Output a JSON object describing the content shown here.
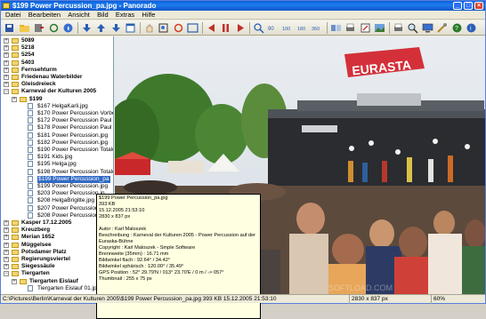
{
  "window": {
    "title": "$199 Power Percussion_pa.jpg - Panorado",
    "icon": "app-icon"
  },
  "menu": [
    "Datei",
    "Bearbeiten",
    "Ansicht",
    "Bild",
    "Extras",
    "Hilfe"
  ],
  "toolbar": [
    "save-icon",
    "folder-icon",
    "exit-icon",
    "refresh-icon",
    "info-icon",
    "arrow-down-icon",
    "arrow-up-icon",
    "arrow-down-icon",
    "new-window-icon",
    "hand-icon",
    "zoom-window-icon",
    "rotate-icon",
    "frame-icon",
    "play-left-icon",
    "pause-icon",
    "play-right-icon",
    "zoom-in-icon",
    "zoom-90-icon",
    "zoom-100-icon",
    "zoom-180-icon",
    "zoom-360-icon",
    "compare-icon",
    "print-icon",
    "edit-icon",
    "image-icon",
    "print-icon",
    "search-icon",
    "screen-icon",
    "settings-icon",
    "help-icon",
    "about-icon"
  ],
  "tree": [
    {
      "label": "5089",
      "type": "folder",
      "indent": 0,
      "bold": true
    },
    {
      "label": "5218",
      "type": "folder",
      "indent": 0,
      "bold": true
    },
    {
      "label": "5254",
      "type": "folder",
      "indent": 0,
      "bold": true
    },
    {
      "label": "5403",
      "type": "folder",
      "indent": 0,
      "bold": true
    },
    {
      "label": "Fernsehturm",
      "type": "folder",
      "indent": 0,
      "bold": true
    },
    {
      "label": "Friedenau Waterbilder",
      "type": "folder",
      "indent": 0,
      "bold": true
    },
    {
      "label": "Gleisdreieck",
      "type": "folder",
      "indent": 0,
      "bold": true
    },
    {
      "label": "Karneval der Kulturen 2005",
      "type": "folder",
      "indent": 0,
      "bold": true,
      "expanded": true
    },
    {
      "label": "$199",
      "type": "folder",
      "indent": 1,
      "bold": true
    },
    {
      "label": "$167 HelgaKarli.jpg",
      "type": "file",
      "indent": 2
    },
    {
      "label": "$170 Power Percussion Vorbe",
      "type": "file",
      "indent": 2
    },
    {
      "label": "$172 Power Percussion Paul s",
      "type": "file",
      "indent": 2
    },
    {
      "label": "$178 Power Percussion Paul s",
      "type": "file",
      "indent": 2
    },
    {
      "label": "$181 Power Percussion.jpg",
      "type": "file",
      "indent": 2
    },
    {
      "label": "$182 Power Percussion.jpg",
      "type": "file",
      "indent": 2
    },
    {
      "label": "$190 Power Percussion Totale",
      "type": "file",
      "indent": 2
    },
    {
      "label": "$191 Kids.jpg",
      "type": "file",
      "indent": 2
    },
    {
      "label": "$195 Helga.jpg",
      "type": "file",
      "indent": 2
    },
    {
      "label": "$198 Power Percussion Totale",
      "type": "file",
      "indent": 2
    },
    {
      "label": "$199 Power Percussion_pa",
      "type": "file",
      "indent": 2,
      "selected": true
    },
    {
      "label": "$199 Power Percussion.jpg",
      "type": "file",
      "indent": 2
    },
    {
      "label": "$203 Power Percussion.jp",
      "type": "file",
      "indent": 2
    },
    {
      "label": "$208 HelgaBrigitte.jpg",
      "type": "file",
      "indent": 2
    },
    {
      "label": "$207 Power Percussion.jpg",
      "type": "file",
      "indent": 2
    },
    {
      "label": "$208 Power Percussion.jp",
      "type": "file",
      "indent": 2
    },
    {
      "label": "Kasper 17.12.2005",
      "type": "folder",
      "indent": 0,
      "bold": true
    },
    {
      "label": "Kreuzberg",
      "type": "folder",
      "indent": 0,
      "bold": true
    },
    {
      "label": "Merian 1652",
      "type": "folder",
      "indent": 0,
      "bold": true
    },
    {
      "label": "Müggelsee",
      "type": "folder",
      "indent": 0,
      "bold": true
    },
    {
      "label": "Potsdamer Platz",
      "type": "folder",
      "indent": 0,
      "bold": true
    },
    {
      "label": "Regierungsviertel",
      "type": "folder",
      "indent": 0,
      "bold": true
    },
    {
      "label": "Siegessäule",
      "type": "folder",
      "indent": 0,
      "bold": true
    },
    {
      "label": "Tiergarten",
      "type": "folder",
      "indent": 0,
      "bold": true,
      "expanded": true
    },
    {
      "label": "Tiergarten Eislauf",
      "type": "folder",
      "indent": 1,
      "bold": true
    },
    {
      "label": "Tiergarten Eislauf 01.jpg",
      "type": "file",
      "indent": 2
    }
  ],
  "tooltip": {
    "lines": [
      "$199 Power Percussion_pa.jpg",
      "393 KB",
      "15.12.2005 21:53:10",
      "2830 x 837 px",
      "",
      "Autor : Karl Maloszek",
      "Beschreibung : Karneval der Kulturen 2005 - Power Percussion auf der",
      "Euraska-Bühne",
      "Copyright : Karl Maloszek - Smple Software",
      "Brennweite (35mm) : 16.71 mm",
      "Bildwinkel flach : 92.64° / 34.42°",
      "Bildwinkel sphärisch : 120.00° / 35.49°",
      "GPS Position : 52° 29.79'N / 013° 23.70'E / 0 m / -> 057°",
      "Thumbnail : 255 x 75 px"
    ]
  },
  "status": {
    "path": "C:\\Pictures\\Berlin\\Karneval der Kulturen 2005\\$199 Power Percussion_pa.jpg  393 KB  15.12.2005 21:53:10",
    "size": "2830 x 837 px",
    "zoom": "60%"
  },
  "image": {
    "banner": "EURASTA",
    "watermark": "SOFTLOAD.COM"
  }
}
